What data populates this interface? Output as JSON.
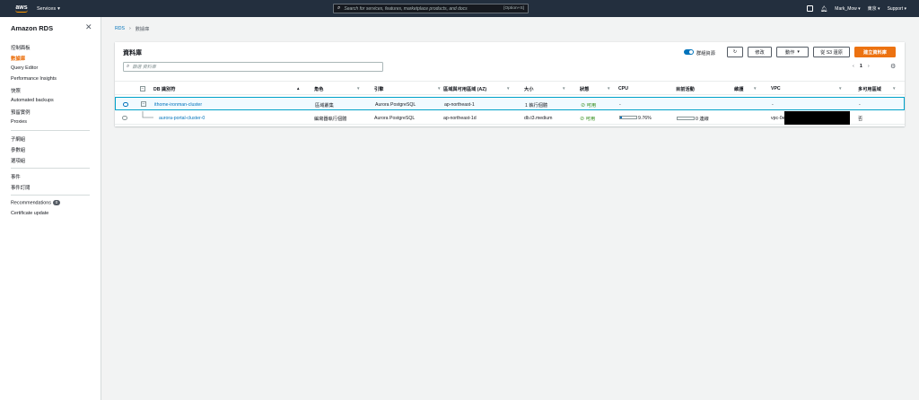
{
  "topnav": {
    "logo": "aws",
    "services": "Services",
    "search_placeholder": "Search for services, features, marketplace products, and docs",
    "search_shortcut": "[Option+S]",
    "user": "Mark_Mow",
    "region": "東京",
    "support": "Support"
  },
  "sidebar": {
    "title": "Amazon RDS",
    "items": [
      {
        "label": "控制面板"
      },
      {
        "label": "數據庫"
      },
      {
        "label": "Query Editor"
      },
      {
        "label": "Performance Insights"
      },
      {
        "label": "快照"
      },
      {
        "label": "Automated backups"
      },
      {
        "label": "預留實例"
      },
      {
        "label": "Proxies"
      },
      {
        "label": "子網組"
      },
      {
        "label": "參數組"
      },
      {
        "label": "選項組"
      },
      {
        "label": "事件"
      },
      {
        "label": "事件訂閱"
      },
      {
        "label": "Recommendations",
        "badge": "0"
      },
      {
        "label": "Certificate update"
      }
    ]
  },
  "breadcrumb": {
    "root": "RDS",
    "current": "數據庫"
  },
  "panel": {
    "title": "資料庫",
    "toggle_label": "群組資源",
    "buttons": {
      "modify": "修改",
      "actions": "動作",
      "restore": "從 S3 還原",
      "create": "建立資料庫"
    },
    "filter_placeholder": "篩選 資料庫",
    "page": "1"
  },
  "table": {
    "headers": [
      "DB 識別符",
      "角色",
      "引擎",
      "區域與可用區域 (AZ)",
      "大小",
      "狀態",
      "CPU",
      "目前活動",
      "維護",
      "VPC",
      "多可用區域"
    ],
    "rows": [
      {
        "id": "ithome-ironman-cluster",
        "role": "區域叢集",
        "engine": "Aurora PostgreSQL",
        "region": "ap-northeast-1",
        "size": "1 執行個體",
        "status": "可用",
        "cpu": "-",
        "activity": "",
        "maintenance": "",
        "vpc": "-",
        "multi_az": "-",
        "selected": true
      },
      {
        "id": "aurora-portal-cluster-0",
        "role": "編寫器執行個體",
        "engine": "Aurora PostgreSQL",
        "region": "ap-northeast-1d",
        "size": "db.t3.medium",
        "status": "可用",
        "cpu": "9.76%",
        "cpu_fraction": 0.0976,
        "activity": "0 連線",
        "maintenance": "",
        "vpc": "vpc-0e",
        "multi_az": "否",
        "selected": false
      }
    ]
  }
}
